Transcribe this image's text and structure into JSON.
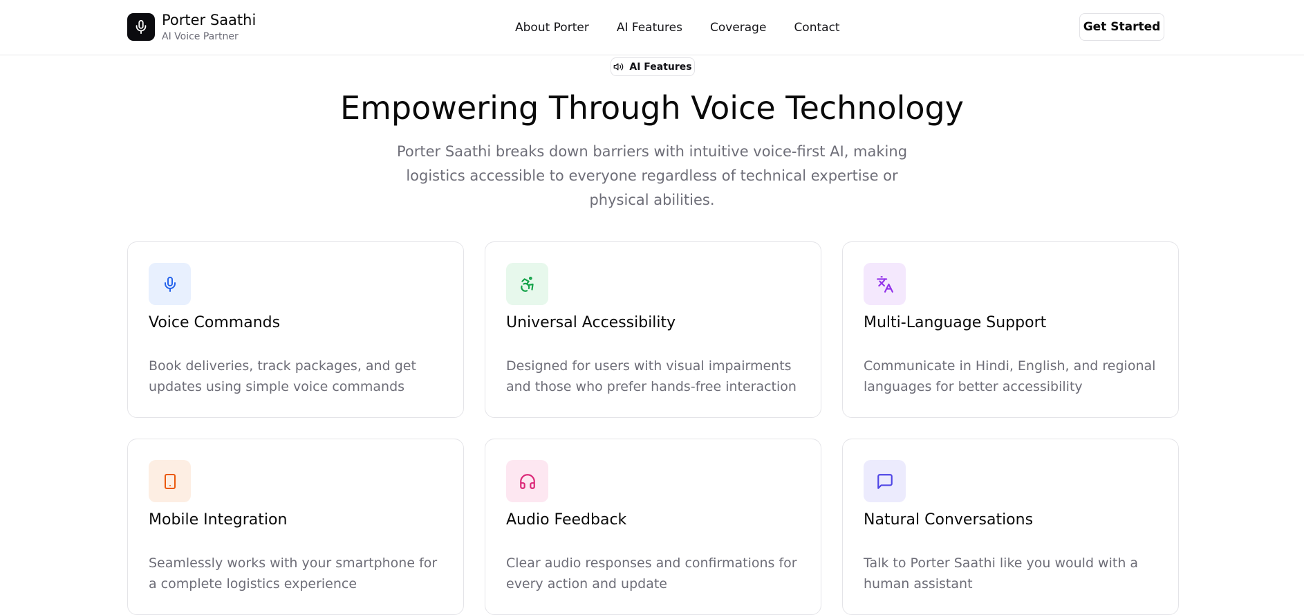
{
  "brand": {
    "title": "Porter Saathi",
    "subtitle": "AI Voice Partner",
    "logo_icon": "mic-icon"
  },
  "nav": {
    "items": [
      "About Porter",
      "AI Features",
      "Coverage",
      "Contact"
    ]
  },
  "header": {
    "cta_label": "Get Started"
  },
  "hero": {
    "badge_label": "AI Features",
    "badge_icon": "speaker-icon",
    "title": "Empowering Through Voice Technology",
    "subtitle": "Porter Saathi breaks down barriers with intuitive voice-first AI, making logistics accessible to everyone regardless of technical expertise or physical abilities."
  },
  "features": [
    {
      "title": "Voice Commands",
      "description": "Book deliveries, track packages, and get updates using simple voice commands",
      "icon": "mic-icon",
      "icon_color": "#2563eb",
      "icon_bg": "#e8f0fe"
    },
    {
      "title": "Universal Accessibility",
      "description": "Designed for users with visual impairments and those who prefer hands-free interaction",
      "icon": "accessibility-icon",
      "icon_color": "#16a34a",
      "icon_bg": "#e7f8ec"
    },
    {
      "title": "Multi-Language Support",
      "description": "Communicate in Hindi, English, and regional languages for better accessibility",
      "icon": "translate-icon",
      "icon_color": "#9333ea",
      "icon_bg": "#f4e8fd"
    },
    {
      "title": "Mobile Integration",
      "description": "Seamlessly works with your smartphone for a complete logistics experience",
      "icon": "tablet-icon",
      "icon_color": "#ea580c",
      "icon_bg": "#fdeee3"
    },
    {
      "title": "Audio Feedback",
      "description": "Clear audio responses and confirmations for every action and update",
      "icon": "headphones-icon",
      "icon_color": "#db2777",
      "icon_bg": "#fde7f1"
    },
    {
      "title": "Natural Conversations",
      "description": "Talk to Porter Saathi like you would with a human assistant",
      "icon": "message-icon",
      "icon_color": "#4f46e5",
      "icon_bg": "#ecebfd"
    }
  ]
}
